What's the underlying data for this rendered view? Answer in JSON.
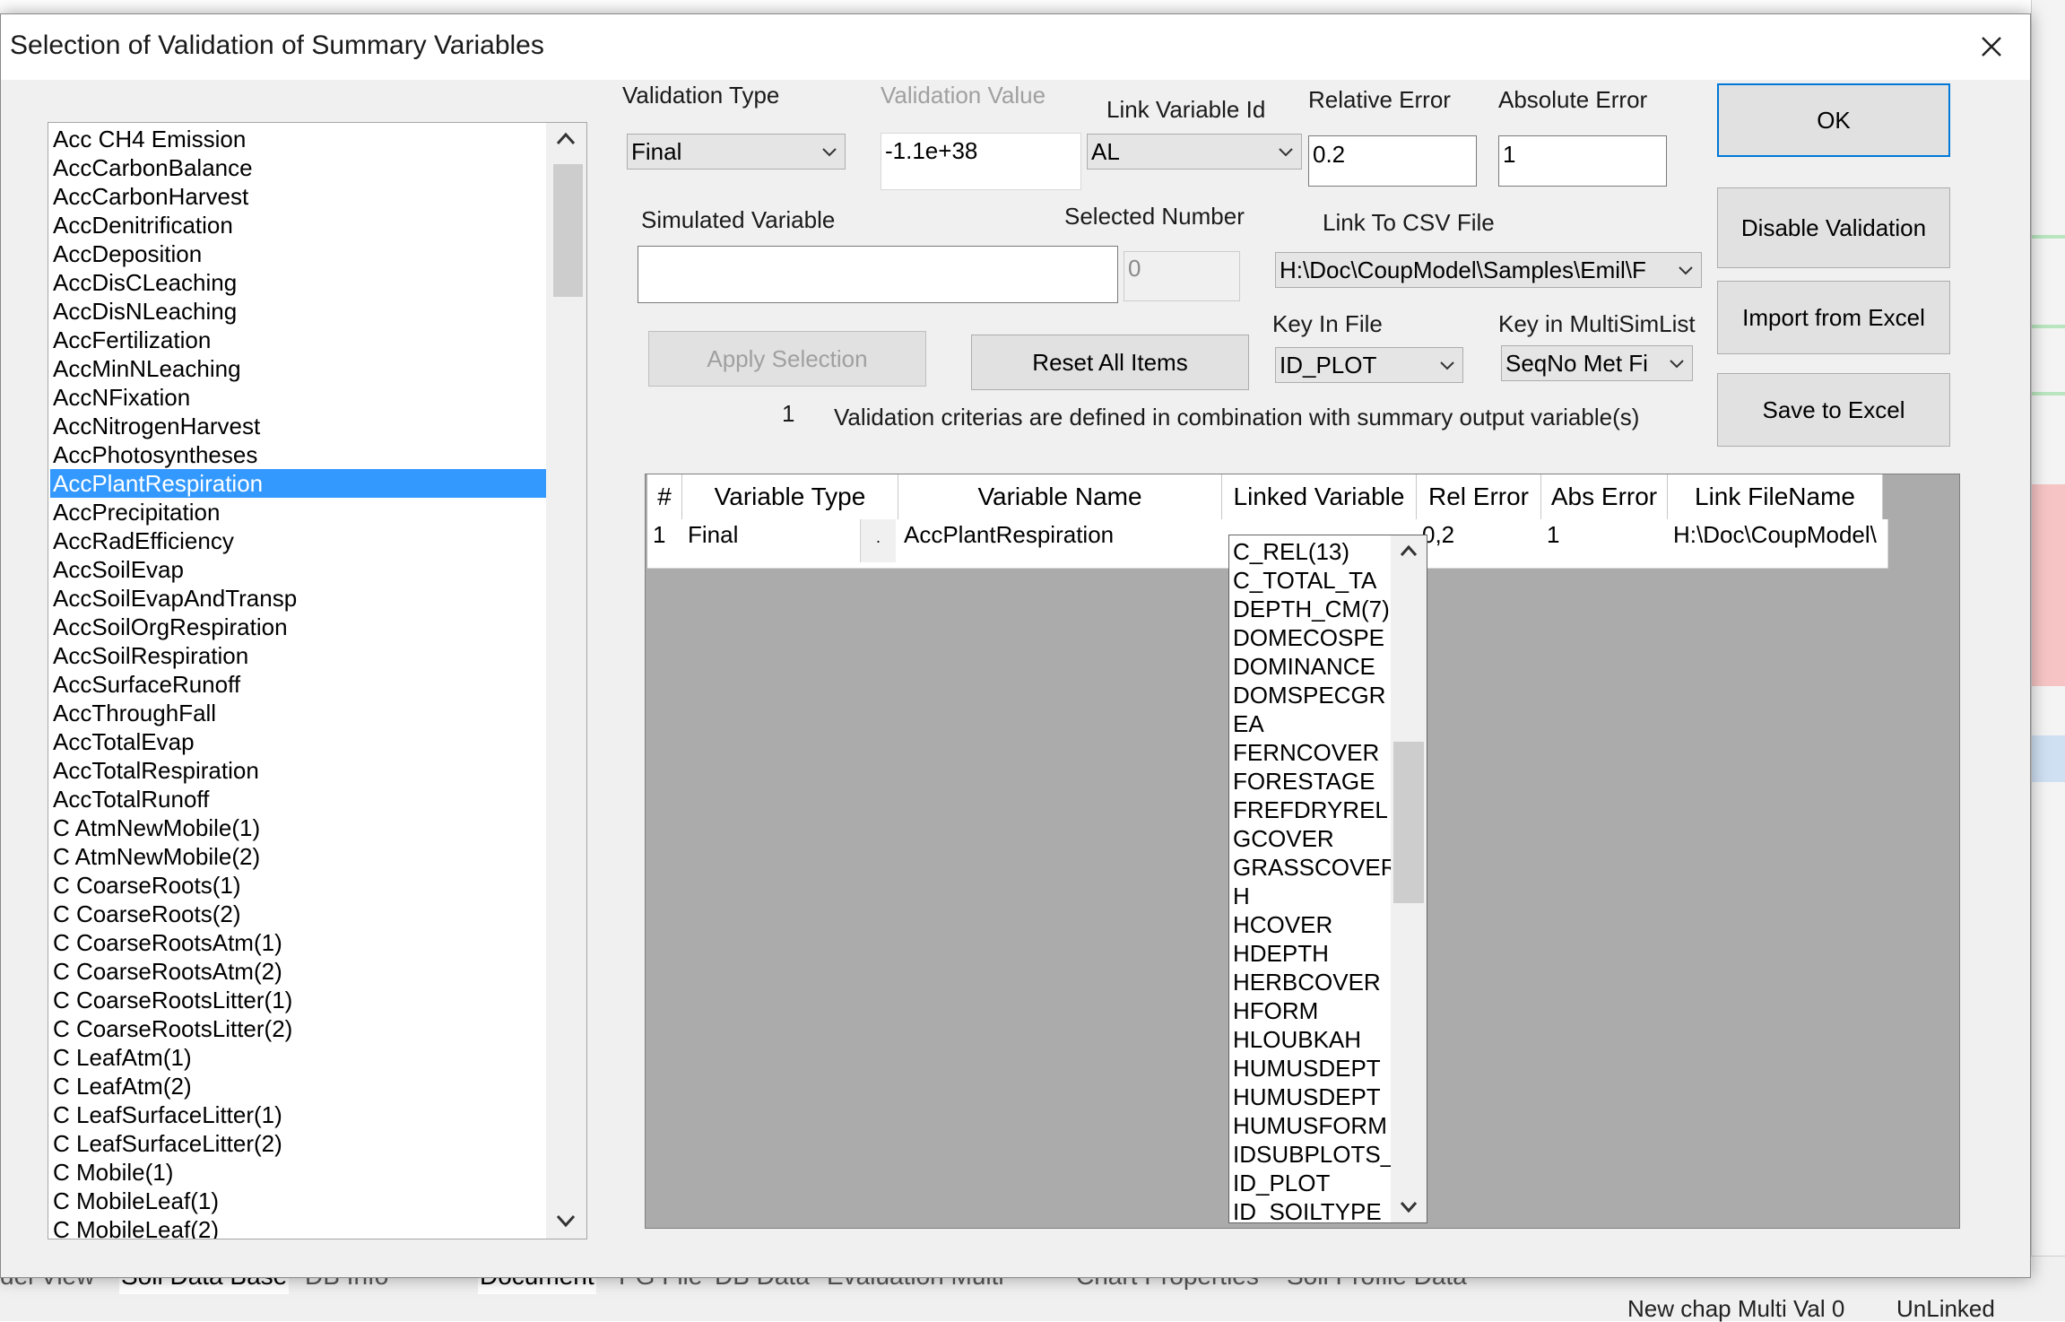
{
  "dialog": {
    "title": "Selection of Validation of Summary Variables"
  },
  "variable_list": {
    "items": [
      "Acc CH4 Emission",
      "AccCarbonBalance",
      "AccCarbonHarvest",
      "AccDenitrification",
      "AccDeposition",
      "AccDisCLeaching",
      "AccDisNLeaching",
      "AccFertilization",
      "AccMinNLeaching",
      "AccNFixation",
      "AccNitrogenHarvest",
      "AccPhotosyntheses",
      "AccPlantRespiration",
      "AccPrecipitation",
      "AccRadEfficiency",
      "AccSoilEvap",
      "AccSoilEvapAndTransp",
      "AccSoilOrgRespiration",
      "AccSoilRespiration",
      "AccSurfaceRunoff",
      "AccThroughFall",
      "AccTotalEvap",
      "AccTotalRespiration",
      "AccTotalRunoff",
      "C AtmNewMobile(1)",
      "C AtmNewMobile(2)",
      "C CoarseRoots(1)",
      "C CoarseRoots(2)",
      "C CoarseRootsAtm(1)",
      "C CoarseRootsAtm(2)",
      "C CoarseRootsLitter(1)",
      "C CoarseRootsLitter(2)",
      "C LeafAtm(1)",
      "C LeafAtm(2)",
      "C LeafSurfaceLitter(1)",
      "C LeafSurfaceLitter(2)",
      "C Mobile(1)",
      "C MobileLeaf(1)",
      "C MobileLeaf(2)"
    ],
    "selected_index": 12
  },
  "form": {
    "validation_type_label": "Validation Type",
    "validation_type_value": "Final",
    "validation_value_label": "Validation Value",
    "validation_value": "-1.1e+38",
    "link_variable_id_label": "Link Variable Id",
    "link_variable_id_value": "AL",
    "relative_error_label": "Relative Error",
    "relative_error_value": "0.2",
    "absolute_error_label": "Absolute Error",
    "absolute_error_value": "1",
    "simulated_variable_label": "Simulated Variable",
    "simulated_variable_value": "",
    "selected_number_label": "Selected Number",
    "selected_number_value": "0",
    "link_csv_label": "Link To CSV File",
    "link_csv_value": "H:\\Doc\\CoupModel\\Samples\\Emil\\F",
    "key_in_file_label": "Key In File",
    "key_in_file_value": "ID_PLOT",
    "key_in_multisim_label": "Key in MultiSimList",
    "key_in_multisim_value": "SeqNo Met Fi",
    "count_value": "1",
    "status_text": "Validation criterias are defined in combination with summary output variable(s)"
  },
  "buttons": {
    "ok": "OK",
    "disable_validation": "Disable Validation",
    "import_excel": "Import from Excel",
    "save_excel": "Save to Excel",
    "apply_selection": "Apply Selection",
    "reset_all": "Reset All Items"
  },
  "grid": {
    "headers": [
      "#",
      "Variable Type",
      "Variable Name",
      "Linked Variable",
      "Rel Error",
      "Abs Error",
      "Link FileName"
    ],
    "row": {
      "num": "1",
      "variable_type": "Final",
      "variable_name": "AccPlantRespiration",
      "linked_variable": "",
      "rel_error": "0,2",
      "abs_error": "1",
      "link_filename": "H:\\Doc\\CoupModel\\"
    }
  },
  "linked_dropdown": {
    "items": [
      "C_REL(13)",
      "C_TOTAL_TA",
      "DEPTH_CM(7)",
      "DOMECOSPE",
      "DOMINANCE",
      "DOMSPECGR",
      "EA",
      "FERNCOVER",
      "FORESTAGE",
      "FREFDRYREL",
      "GCOVER",
      "GRASSCOVER",
      "H",
      "HCOVER",
      "HDEPTH",
      "HERBCOVER",
      "HFORM",
      "HLOUBKAH",
      "HUMUSDEPT",
      "HUMUSDEPT",
      "HUMUSFORM",
      "IDSUBPLOTS_",
      "ID_PLOT",
      "ID_SOILTYPE"
    ]
  },
  "background": {
    "tabs": [
      "del View",
      "Soil Data Base",
      "DB Info",
      "Document",
      "PG File",
      "DB Data",
      "Evaluation Multi",
      "Chart Properties",
      "Soil Profile Data"
    ],
    "status_texts": [
      "New chap Multi Val 0",
      "UnLinked"
    ]
  },
  "colors": {
    "selection": "#3399ff",
    "dialog_bg": "#f0f0f0",
    "grid_bg": "#ababab",
    "default_button_border": "#0078d7"
  }
}
